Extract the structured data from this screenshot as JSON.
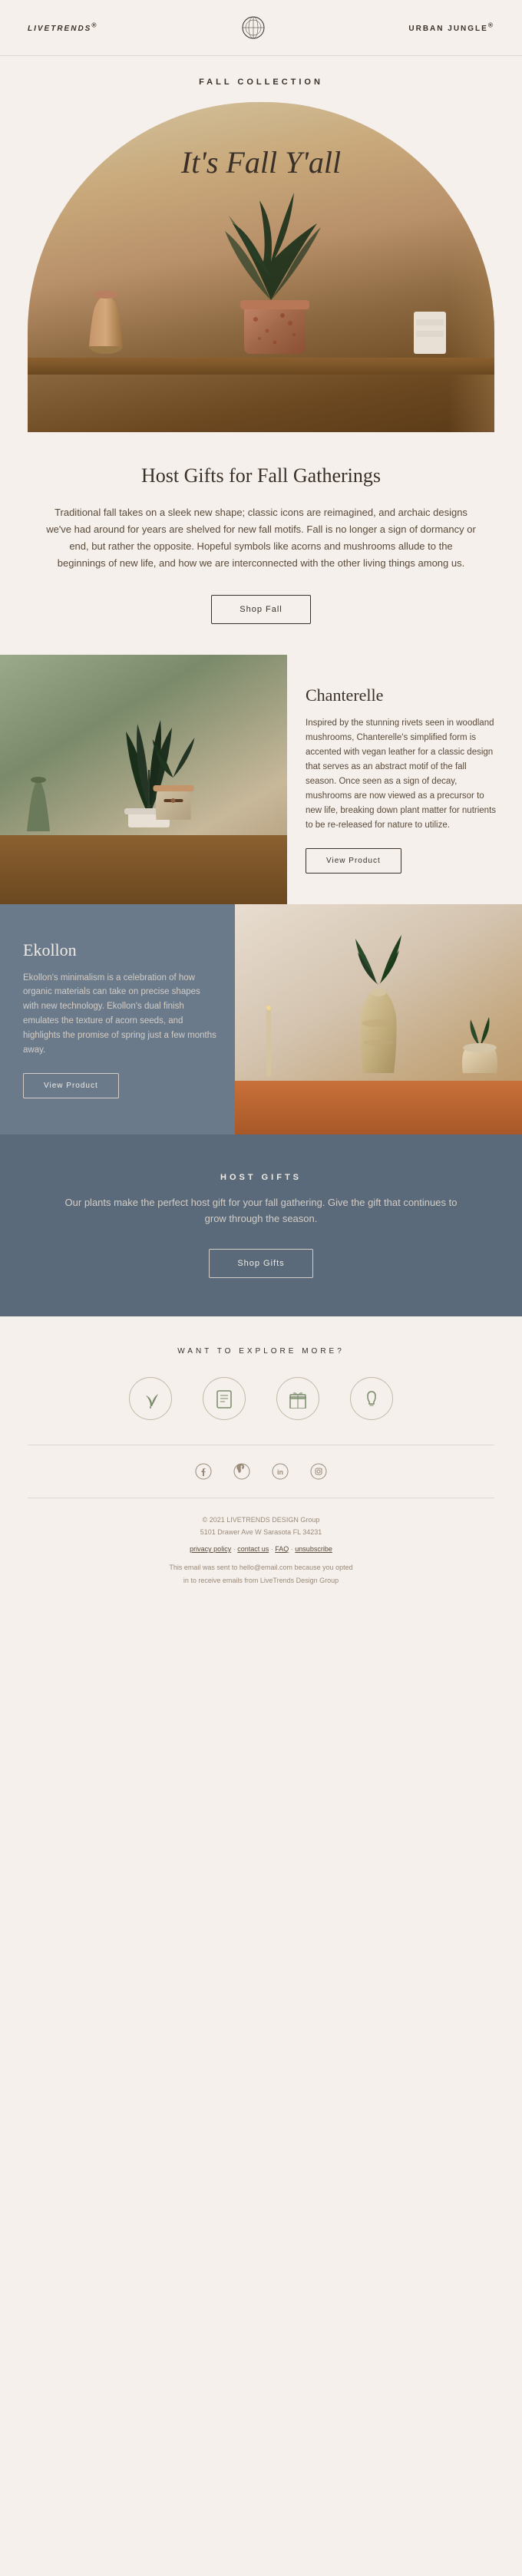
{
  "header": {
    "logo_left": "LIVETRENDS",
    "logo_left_super": "®",
    "logo_right": "URBAN JUNGLE",
    "logo_right_super": "®"
  },
  "hero": {
    "collection_label": "FALL COLLECTION",
    "title": "It's Fall Y'all"
  },
  "intro": {
    "heading": "Host Gifts for Fall Gatherings",
    "body": "Traditional fall takes on a sleek new shape; classic icons are reimagined, and archaic designs we've had around for years are shelved for new fall motifs. Fall is no longer a sign of dormancy or end, but rather the opposite. Hopeful symbols like acorns and mushrooms allude to the beginnings of new life, and how we are interconnected with the other living things among us.",
    "shop_button": "Shop Fall"
  },
  "chanterelle": {
    "name": "Chanterelle",
    "description": "Inspired by the stunning rivets seen in woodland mushrooms, Chanterelle's simplified form is accented with vegan leather for a classic design that serves as an abstract motif of the fall season.\n\nOnce seen as a sign of decay, mushrooms are now viewed as a precursor to new life, breaking down plant matter for nutrients to be re-released for nature to utilize.",
    "button": "View Product"
  },
  "ekollon": {
    "name": "Ekollon",
    "description": "Ekollon's minimalism is a celebration of how organic materials can take on precise shapes with new technology. Ekollon's dual finish emulates the texture of acorn seeds, and highlights the promise of spring just a few months away.",
    "button": "View Product"
  },
  "host_gifts": {
    "label": "HOST GIFTS",
    "description": "Our plants make the perfect host gift for your fall gathering. Give the gift that continues to grow through the season.",
    "button": "Shop Gifts"
  },
  "explore": {
    "label": "WANT TO EXPLORE MORE?",
    "icons": [
      {
        "name": "plant-icon",
        "symbol": "🌱",
        "label": ""
      },
      {
        "name": "catalog-icon",
        "symbol": "📋",
        "label": ""
      },
      {
        "name": "gift-icon",
        "symbol": "🎁",
        "label": ""
      },
      {
        "name": "bulb-icon",
        "symbol": "💡",
        "label": ""
      }
    ]
  },
  "social": {
    "icons": [
      "f",
      "p",
      "in",
      "inst"
    ]
  },
  "footer": {
    "line1": "© 2021 LIVETRENDS DESIGN Group",
    "line2": "5101 Drawer Ave W Sarasota FL 34231",
    "privacy": "privacy policy",
    "separator": "·",
    "contact": "contact us",
    "faq": "FAQ",
    "unsubscribe": "unsubscribe",
    "disclaimer1": "This email was sent to hello@email.com because you opted",
    "disclaimer2": "in to receive emails from LiveTrends Design Group"
  }
}
